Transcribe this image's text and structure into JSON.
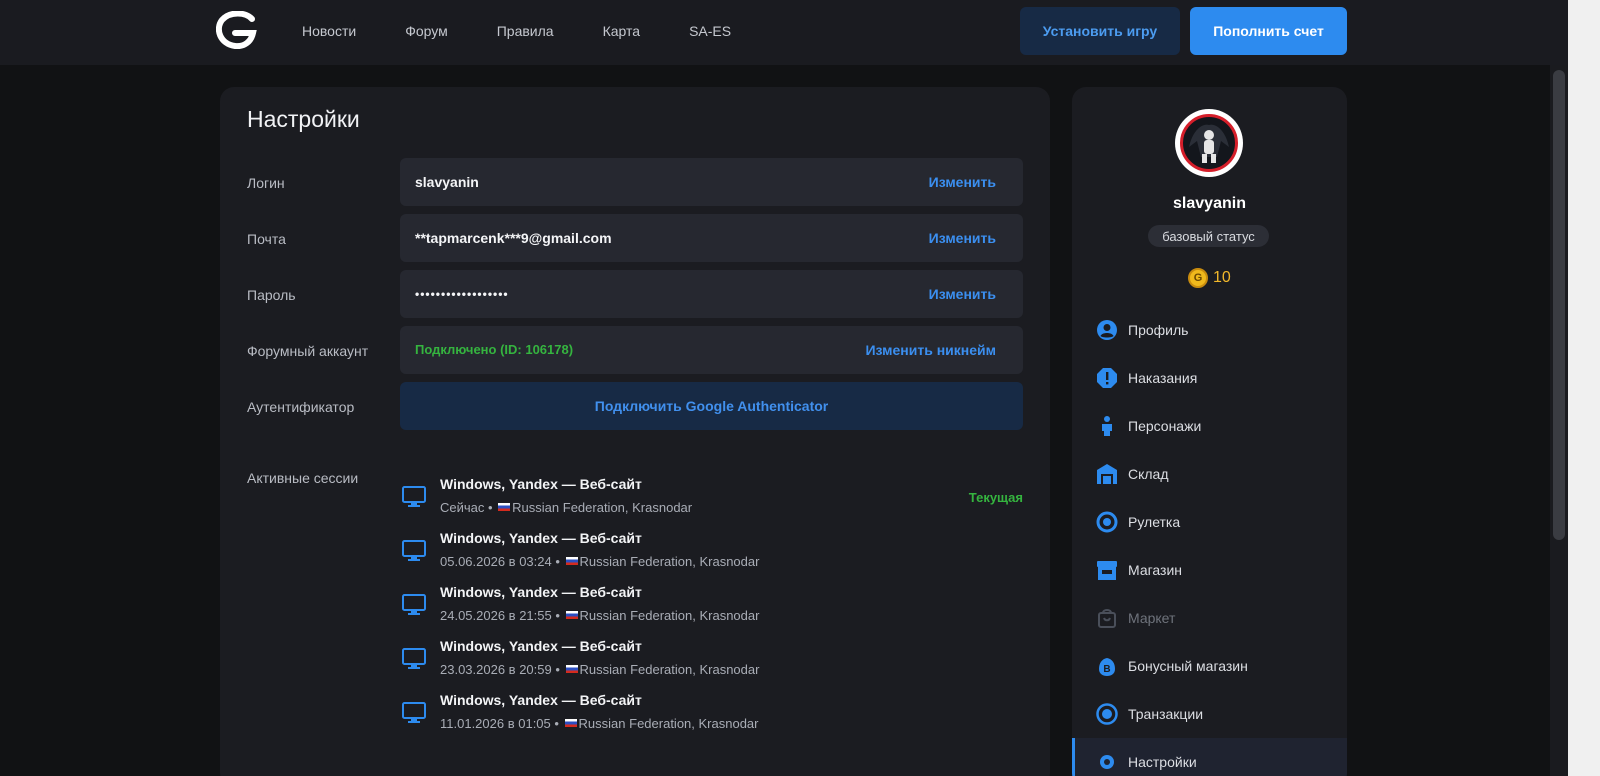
{
  "header": {
    "nav": [
      "Новости",
      "Форум",
      "Правила",
      "Карта",
      "SA-ES"
    ],
    "install_label": "Установить игру",
    "topup_label": "Пополнить счет"
  },
  "settings": {
    "title": "Настройки",
    "login": {
      "label": "Логин",
      "value": "slavyanin",
      "action": "Изменить"
    },
    "email": {
      "label": "Почта",
      "value": "**tapmarcenk***9@gmail.com",
      "action": "Изменить"
    },
    "password": {
      "label": "Пароль",
      "value": "••••••••••••••••••",
      "action": "Изменить"
    },
    "forum": {
      "label": "Форумный аккаунт",
      "value": "Подключено (ID: 106178)",
      "action": "Изменить никнейм"
    },
    "auth": {
      "label": "Аутентификатор",
      "button": "Подключить Google Authenticator"
    },
    "sessions_label": "Активные сессии",
    "sessions": [
      {
        "title": "Windows, Yandex — Веб-сайт",
        "time": "Сейчас",
        "location": "Russian Federation, Krasnodar",
        "current": "Текущая"
      },
      {
        "title": "Windows, Yandex — Веб-сайт",
        "time": "05.06.2026 в 03:24",
        "location": "Russian Federation, Krasnodar"
      },
      {
        "title": "Windows, Yandex — Веб-сайт",
        "time": "24.05.2026 в 21:55",
        "location": "Russian Federation, Krasnodar"
      },
      {
        "title": "Windows, Yandex — Веб-сайт",
        "time": "23.03.2026 в 20:59",
        "location": "Russian Federation, Krasnodar"
      },
      {
        "title": "Windows, Yandex — Веб-сайт",
        "time": "11.01.2026 в 01:05",
        "location": "Russian Federation, Krasnodar"
      }
    ]
  },
  "sidebar": {
    "username": "slavyanin",
    "status": "базовый статус",
    "coins": "10",
    "coin_glyph": "G",
    "menu": [
      "Профиль",
      "Наказания",
      "Персонажи",
      "Склад",
      "Рулетка",
      "Магазин",
      "Маркет",
      "Бонусный магазин",
      "Транзакции",
      "Настройки"
    ]
  },
  "colors": {
    "accent": "#2d8bef",
    "success": "#35b43f",
    "coin": "#f0b91c"
  }
}
